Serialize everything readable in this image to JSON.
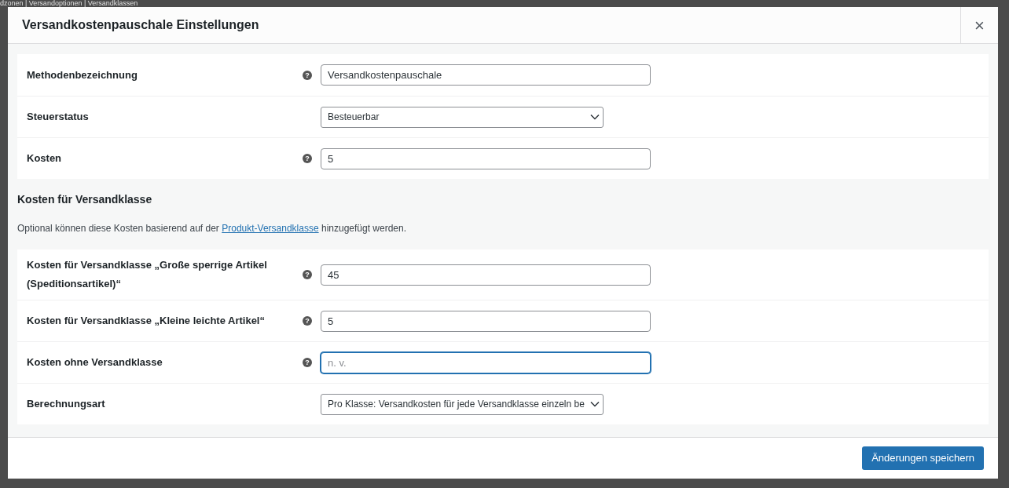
{
  "background": {
    "breadcrumb": "dzonen | Versandoptionen | Versandklassen"
  },
  "modal": {
    "title": "Versandkostenpauschale Einstellungen",
    "close": "×"
  },
  "general_rows": [
    {
      "kind": "text",
      "label": "Methodenbezeichnung",
      "help": "?",
      "value": "Versandkostenpauschale",
      "focused": false
    },
    {
      "kind": "select",
      "label": "Steuerstatus",
      "value": "Besteuerbar"
    },
    {
      "kind": "text",
      "label": "Kosten",
      "help": "?",
      "value": "5",
      "focused": false
    }
  ],
  "class_section": {
    "heading": "Kosten für Versandklasse",
    "description_before": "Optional können diese Kosten basierend auf der",
    "link": "Produkt-Versandklasse",
    "description_after": "hinzugefügt werden."
  },
  "class_rows": [
    {
      "kind": "text",
      "label": "Kosten für Versandklasse „Große sperrige Artikel (Speditionsartikel)“",
      "help": "?",
      "value": "45",
      "focused": false
    },
    {
      "kind": "text",
      "label": "Kosten für Versandklasse „Kleine leichte Artikel“",
      "help": "?",
      "value": "5",
      "focused": false
    },
    {
      "kind": "text",
      "label": "Kosten ohne Versandklasse",
      "help": "?",
      "placeholder": "n. v.",
      "focused": true
    },
    {
      "kind": "select",
      "label": "Berechnungsart",
      "value": "Pro Klasse: Versandkosten für jede Versandklasse einzeln be"
    }
  ],
  "footer": {
    "save_button": "Änderungen speichern"
  }
}
